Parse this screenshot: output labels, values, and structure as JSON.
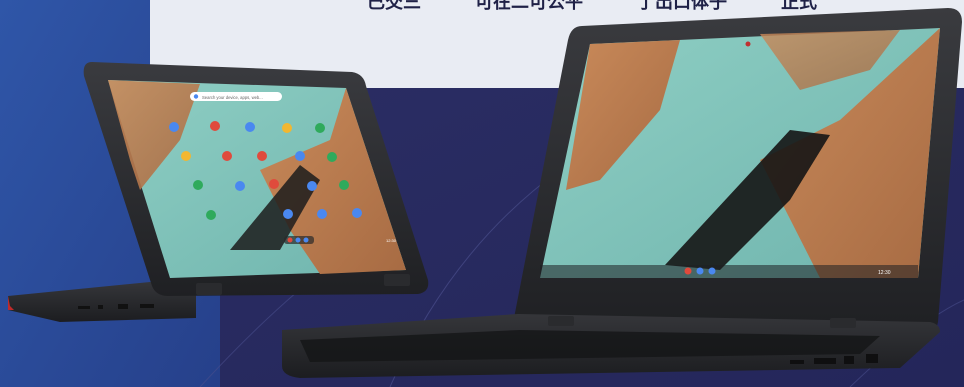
{
  "top_strip": {
    "fragments": [
      "已交三",
      "可在二可公平",
      "了出口体子",
      "正式"
    ]
  },
  "left_device": {
    "search_placeholder": "Search your device, apps, web...",
    "shelf_time": "12:30"
  },
  "right_device": {
    "shelf_time": "12:30"
  },
  "colors": {
    "navy": "#2a2d5e",
    "blue_accent": "#2a4b9a",
    "light_panel": "#e9ecf3",
    "device_body": "#2b2c2f"
  }
}
